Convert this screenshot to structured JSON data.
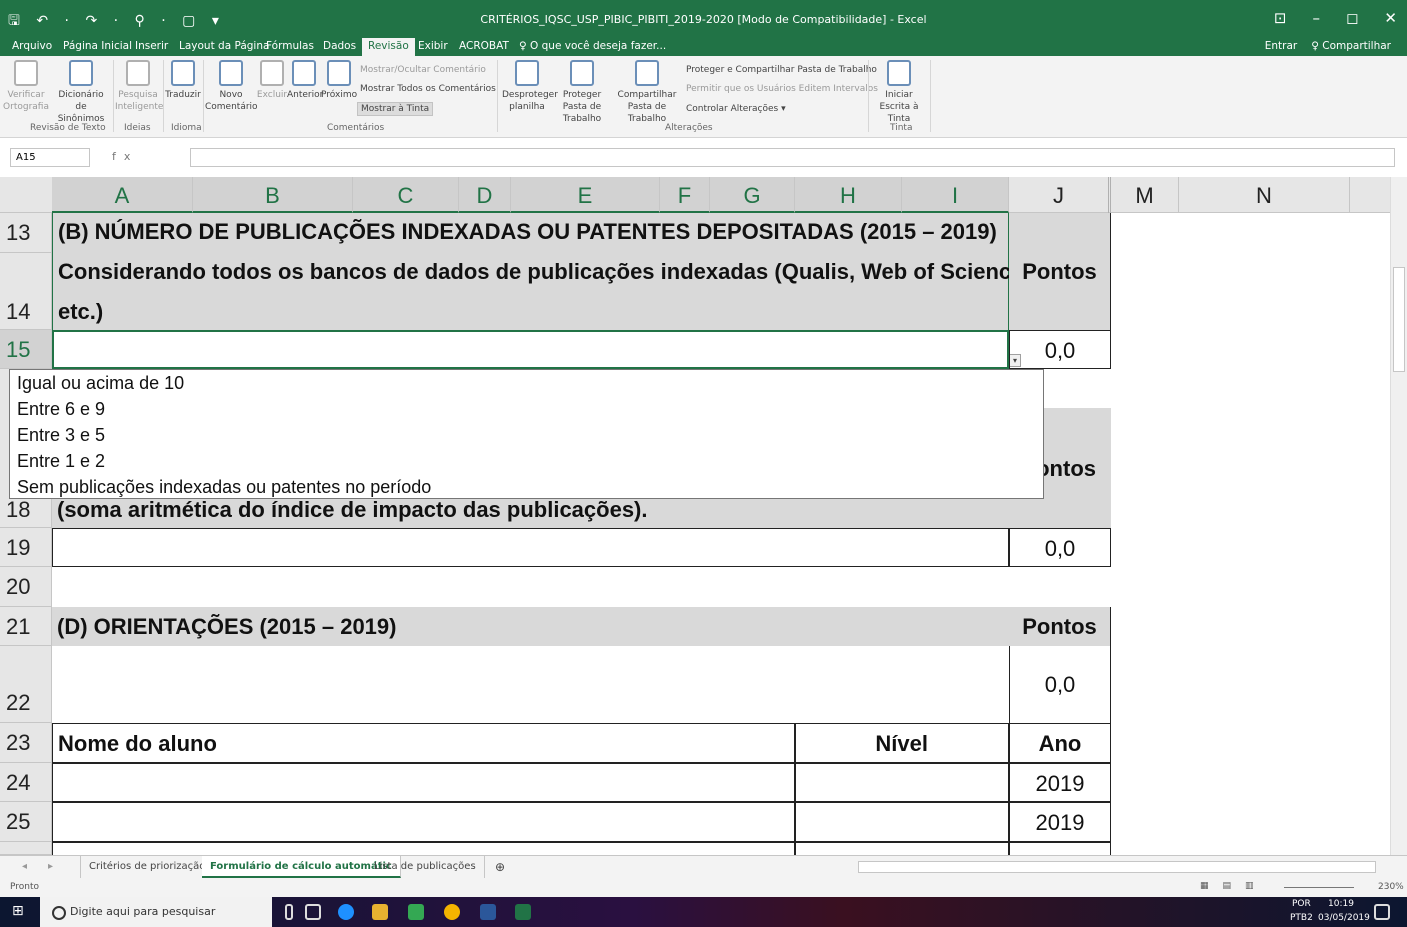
{
  "window": {
    "title": "CRITÉRIOS_IQSC_USP_PIBIC_PIBITI_2019-2020  [Modo de Compatibilidade] - Excel",
    "controls": [
      "⊡",
      "–",
      "◻",
      "✕"
    ],
    "qat": "🖫 ↶ · ↷ · ⚲ · ▢ ▾"
  },
  "menu": {
    "tabs": [
      "Arquivo",
      "Página Inicial",
      "Inserir",
      "Layout da Página",
      "Fórmulas",
      "Dados",
      "Revisão",
      "Exibir",
      "ACROBAT"
    ],
    "active": "Revisão",
    "tell_me": "♀ O que você deseja fazer...",
    "signin": "Entrar",
    "share": "♀ Compartilhar"
  },
  "ribbon": {
    "spelling": "Verificar Ortografia",
    "thesaurus": "Dicionário de Sinônimos",
    "smart_lookup": "Pesquisa Inteligente",
    "translate": "Traduzir",
    "new_comment": "Novo Comentário",
    "delete": "Excluir",
    "previous": "Anterior",
    "next": "Próximo",
    "show_hide_comment": "Mostrar/Ocultar Comentário",
    "show_all_comments": "Mostrar Todos os Comentários",
    "show_ink": "Mostrar à Tinta",
    "unprotect_sheet": "Desproteger planilha",
    "protect_workbook": "Proteger Pasta de Trabalho",
    "share_workbook": "Compartilhar Pasta de Trabalho",
    "protect_share": "Proteger e Compartilhar Pasta de Trabalho",
    "allow_edit": "Permitir que os Usuários Editem Intervalos",
    "track_changes": "Controlar Alterações ▾",
    "start_inking": "Iniciar Escrita à Tinta",
    "groups": {
      "proofing": "Revisão de Texto",
      "insights": "Ideias",
      "language": "Idioma",
      "comments": "Comentários",
      "changes": "Alterações",
      "ink": "Tinta"
    }
  },
  "formula_bar": {
    "name_box": "A15",
    "fx": "fx",
    "value": ""
  },
  "columns": [
    "A",
    "B",
    "C",
    "D",
    "E",
    "F",
    "G",
    "H",
    "I",
    "J",
    "M",
    "N"
  ],
  "rows": [
    "13",
    "14",
    "15",
    "18",
    "19",
    "20",
    "21",
    "22",
    "23",
    "24",
    "25"
  ],
  "cells": {
    "r13": "(B) NÚMERO DE PUBLICAÇÕES INDEXADAS OU PATENTES DEPOSITADAS (2015 – 2019)",
    "r14a": "Considerando todos os bancos de dados de publicações indexadas (Qualis, Web of Science,",
    "r14b": "etc.)",
    "pontos": "Pontos",
    "pontos_partial": "ontos",
    "r15j": "0,0",
    "r18": "(soma aritmética do índice de impacto das publicações).",
    "r19j": "0,0",
    "r21": "(D) ORIENTAÇÕES (2015 – 2019)",
    "r21j": "Pontos",
    "r22j": "0,0",
    "r23a": "Nome do aluno",
    "r23h": "Nível",
    "r23j": "Ano",
    "r24j": "2019",
    "r25j": "2019"
  },
  "dropdown": {
    "options": [
      "Igual ou acima de 10",
      "Entre 6 e 9",
      "Entre 3 e 5",
      "Entre 1 e 2",
      "Sem publicações indexadas ou patentes no período"
    ]
  },
  "sheets": {
    "tabs": [
      "Critérios de priorização",
      "Formulário de cálculo automátic",
      "Lista de publicações"
    ],
    "active": "Formulário de cálculo automátic",
    "add": "⊕"
  },
  "status": {
    "ready": "Pronto",
    "zoom": "230%"
  },
  "taskbar": {
    "search": "Digite aqui para pesquisar",
    "lang": "POR",
    "layout": "PTB2",
    "time": "10:19",
    "date": "03/05/2019"
  }
}
